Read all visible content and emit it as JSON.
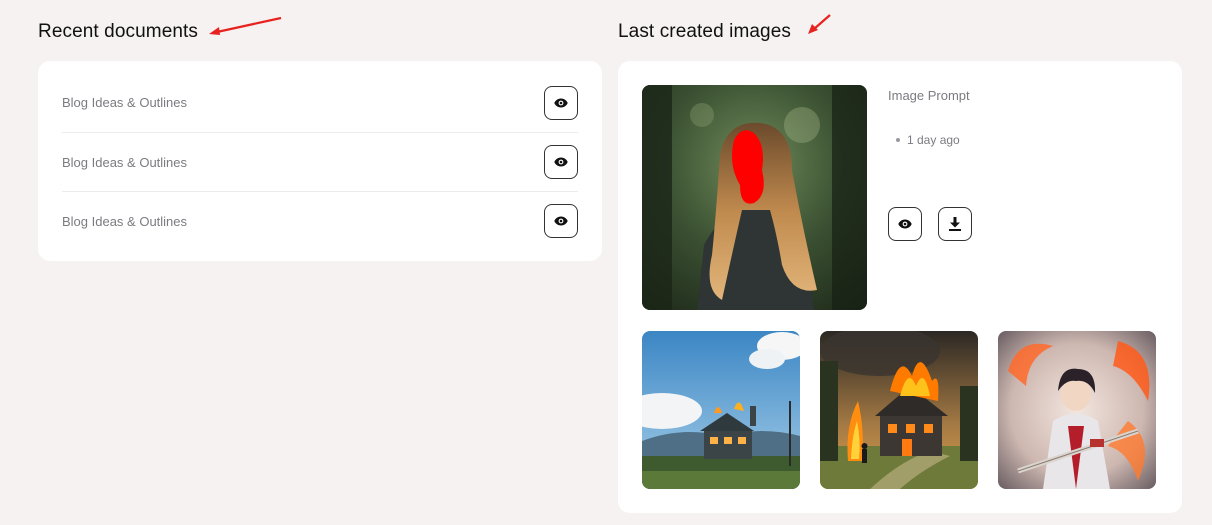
{
  "recent_documents": {
    "title": "Recent documents",
    "items": [
      {
        "name": "Blog Ideas & Outlines",
        "action_icon": "eye-icon"
      },
      {
        "name": "Blog Ideas & Outlines",
        "action_icon": "eye-icon"
      },
      {
        "name": "Blog Ideas & Outlines",
        "action_icon": "eye-icon"
      }
    ]
  },
  "last_images": {
    "title": "Last created images",
    "featured": {
      "prompt_label": "Image Prompt",
      "time": "1 day ago",
      "actions": [
        "eye-icon",
        "download-icon"
      ]
    },
    "thumbnails": [
      "house-landscape-image",
      "burning-house-image",
      "anime-warrior-image"
    ]
  },
  "colors": {
    "background": "#f5f2f1",
    "card": "#ffffff",
    "annotation_arrow": "#e8221f",
    "muted_text": "#7b7b80"
  }
}
